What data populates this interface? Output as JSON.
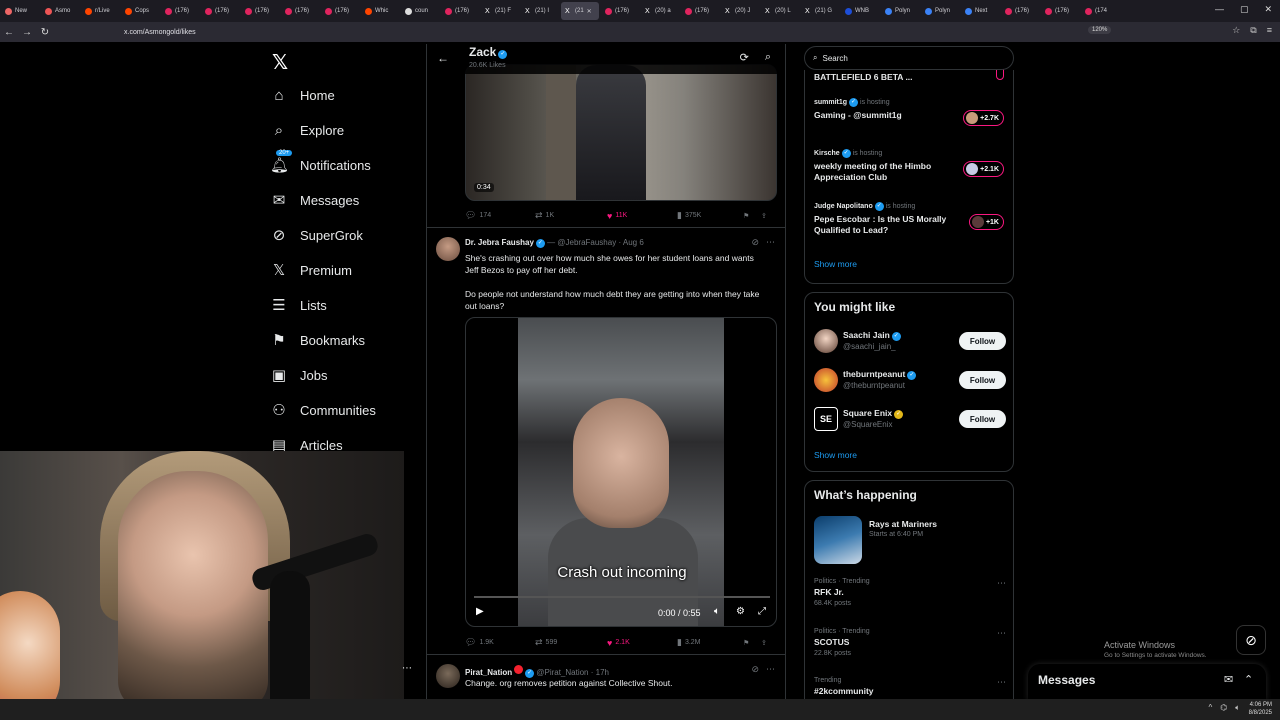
{
  "browser": {
    "tabs": [
      {
        "label": "New"
      },
      {
        "label": "Asmo"
      },
      {
        "label": "r/Live"
      },
      {
        "label": "Cops"
      },
      {
        "label": "(176)"
      },
      {
        "label": "(176)"
      },
      {
        "label": "(176)"
      },
      {
        "label": "(176)"
      },
      {
        "label": "(176)"
      },
      {
        "label": "Whic"
      },
      {
        "label": "coun"
      },
      {
        "label": "(176)"
      },
      {
        "label": "(21) F"
      },
      {
        "label": "(21) I"
      },
      {
        "label": "(21"
      },
      {
        "label": "(176)"
      },
      {
        "label": "(20) a"
      },
      {
        "label": "(176)"
      },
      {
        "label": "(20) J"
      },
      {
        "label": "(20) L"
      },
      {
        "label": "(21) G"
      },
      {
        "label": "WNB"
      },
      {
        "label": "Polyn"
      },
      {
        "label": "Polyn"
      },
      {
        "label": "Next"
      },
      {
        "label": "(176)"
      },
      {
        "label": "(176)"
      },
      {
        "label": "(174"
      }
    ],
    "url": "x.com/Asmongold/likes",
    "zoom": "120%"
  },
  "nav": {
    "items": [
      {
        "label": "Home",
        "icon": "home-icon"
      },
      {
        "label": "Explore",
        "icon": "search-icon"
      },
      {
        "label": "Notifications",
        "icon": "bell-icon",
        "badge": "20+"
      },
      {
        "label": "Messages",
        "icon": "envelope-icon"
      },
      {
        "label": "SuperGrok",
        "icon": "grok-icon"
      },
      {
        "label": "Premium",
        "icon": "x-icon"
      },
      {
        "label": "Lists",
        "icon": "list-icon"
      },
      {
        "label": "Bookmarks",
        "icon": "bookmark-icon"
      },
      {
        "label": "Jobs",
        "icon": "briefcase-icon"
      },
      {
        "label": "Communities",
        "icon": "people-icon"
      },
      {
        "label": "Articles",
        "icon": "article-icon"
      }
    ]
  },
  "header": {
    "name": "Zack",
    "likes": "20.6K Likes"
  },
  "tweet1": {
    "duration": "0:34",
    "replies": "174",
    "reposts": "1K",
    "likes": "11K",
    "views": "375K"
  },
  "tweet2": {
    "name": "Dr. Jebra Faushay",
    "handle": "@JebraFaushay",
    "date": "Aug 6",
    "text1": "She's crashing out over how much she owes for her student loans and wants Jeff Bezos to pay off her debt.",
    "text2": "Do people not understand how much debt they are getting into when they take out loans?",
    "caption": "Crash out incoming",
    "time": "0:00 / 0:55",
    "replies": "1.9K",
    "reposts": "599",
    "likes": "2.1K",
    "views": "3.2M"
  },
  "tweet3": {
    "name": "Pirat_Nation",
    "handle": "@Pirat_Nation",
    "date": "17h",
    "text": "Change. org removes petition against Collective Shout."
  },
  "right": {
    "search_placeholder": "Search",
    "spaces": [
      {
        "host": "",
        "hosting": "",
        "title": "BATTLEFIELD 6 BETA ...",
        "count": ""
      },
      {
        "host": "summit1g",
        "hosting": "is hosting",
        "title": "Gaming - @summit1g",
        "count": "+2.7K"
      },
      {
        "host": "Kirsche",
        "hosting": "is hosting",
        "title": "weekly meeting of the Himbo Appreciation Club",
        "count": "+2.1K"
      },
      {
        "host": "Judge Napolitano",
        "hosting": "is hosting",
        "title": "Pepe Escobar : Is the US Morally Qualified to Lead?",
        "count": "+1K"
      }
    ],
    "show_more": "Show more",
    "you_might_like": "You might like",
    "follows": [
      {
        "name": "Saachi Jain",
        "handle": "@saachi_jain_",
        "button": "Follow",
        "color": "#c9a68f"
      },
      {
        "name": "theburntpeanut",
        "handle": "@theburntpeanut",
        "button": "Follow",
        "color": "#e8b923"
      },
      {
        "name": "Square Enix",
        "handle": "@SquareEnix",
        "button": "Follow",
        "color": "#ffffff"
      }
    ],
    "whats_happening": "What’s happening",
    "event": {
      "name": "Rays at Mariners",
      "time": "Starts at 6:40 PM"
    },
    "trends": [
      {
        "context": "Politics · Trending",
        "name": "RFK Jr.",
        "count": "68.4K posts"
      },
      {
        "context": "Politics · Trending",
        "name": "SCOTUS",
        "count": "22.8K posts"
      },
      {
        "context": "Trending",
        "name": "#2kcommunity",
        "count": ""
      }
    ]
  },
  "overlay": {
    "activate_title": "Activate Windows",
    "activate_sub": "Go to Settings to activate Windows.",
    "messages": "Messages"
  },
  "taskbar": {
    "time": "4:06 PM",
    "date": "8/8/2025"
  }
}
